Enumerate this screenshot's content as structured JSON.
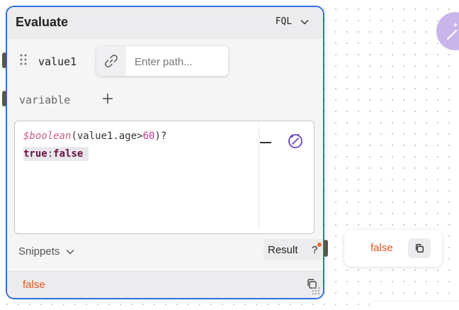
{
  "node": {
    "title": "Evaluate",
    "language": "FQL",
    "input": {
      "name": "value1",
      "path_placeholder": "Enter path..."
    },
    "variable_label": "variable",
    "editor": {
      "line1": {
        "fn": "$boolean",
        "open": "(",
        "expr": "value1.age>",
        "num": "60",
        "close": ")?"
      },
      "line2": {
        "kw_true": "true",
        "sep": ":",
        "kw_false": "false"
      }
    },
    "snippets_label": "Snippets",
    "result_label": "Result",
    "result_help": "?",
    "output_value": "false"
  },
  "result_popover": {
    "value": "false"
  },
  "icons": {
    "language_chevron": "chevron-down-icon",
    "drag": "drag-handle-icon",
    "link": "link-icon",
    "add": "plus-icon",
    "wand": "magic-wand-icon",
    "snippets_chevron": "chevron-down-icon",
    "copy": "copy-icon",
    "resize": "resize-grip-icon",
    "ai": "magic-wand-icon"
  },
  "colors": {
    "node_border": "#2f6fe0",
    "value_orange": "#e0531e",
    "keyword": "#6a1247",
    "function": "#c85a8a",
    "ai_fab": "#c9b5ea"
  }
}
